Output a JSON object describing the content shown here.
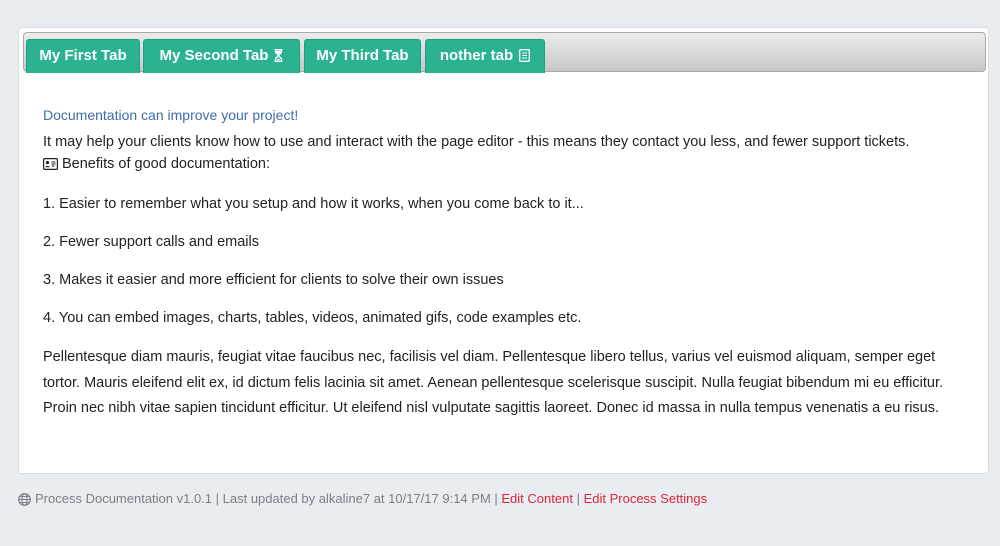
{
  "tabs": [
    {
      "label": "My First Tab",
      "icon": ""
    },
    {
      "label": "My Second Tab",
      "icon": "hourglass-icon"
    },
    {
      "label": "My Third Tab",
      "icon": ""
    },
    {
      "label": "nother tab",
      "icon": "book-icon"
    }
  ],
  "content": {
    "title": "Documentation can improve your project!",
    "intro": "It may help your clients know how to use and interact with the page editor - this means they contact you less, and fewer support tickets.",
    "benefits_label": "Benefits of good documentation:",
    "items": [
      "1. Easier to remember what you setup and how it works, when you come back to it...",
      "2. Fewer support calls and emails",
      "3. Makes it easier and more efficient for clients to solve their own issues",
      "4. You can embed images, charts, tables, videos, animated gifs, code examples etc."
    ],
    "lorem": "Pellentesque diam mauris, feugiat vitae faucibus nec, facilisis vel diam. Pellentesque libero tellus, varius vel euismod aliquam, semper eget tortor. Mauris eleifend elit ex, id dictum felis lacinia sit amet. Aenean pellentesque scelerisque suscipit. Nulla feugiat bibendum mi eu efficitur. Proin nec nibh vitae sapien tincidunt efficitur. Ut eleifend nisl vulputate sagittis laoreet. Donec id massa in nulla tempus venenatis a eu risus."
  },
  "footer": {
    "info": "Process Documentation v1.0.1 | Last updated by alkaline7 at 10/17/17 9:14 PM |",
    "edit_content": "Edit Content",
    "separator": "|",
    "edit_settings": "Edit Process Settings"
  },
  "colors": {
    "tab_green": "#2bb28f",
    "title_blue": "#3d6da8",
    "link_red": "#d9283c",
    "page_bg": "#e9edf2"
  }
}
